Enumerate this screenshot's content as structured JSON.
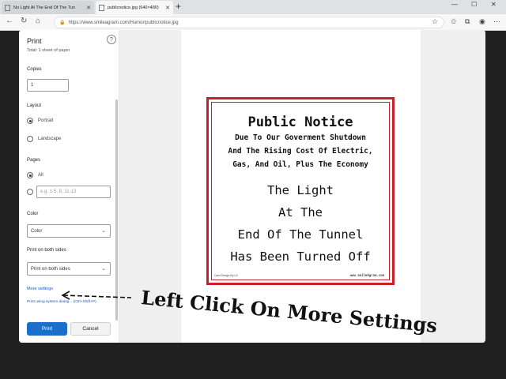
{
  "browser": {
    "tabs": [
      {
        "title": "No Light At The End Of The Tun",
        "active": false
      },
      {
        "title": "publicnotice.jpg (640×480)",
        "active": true
      }
    ],
    "url": "https://www.smileagram.com/Humor/publicnotice.jpg",
    "icons": [
      "back-icon",
      "refresh-icon",
      "home-icon",
      "lock-icon",
      "star-icon",
      "favorites-icon",
      "collections-icon",
      "profile-icon",
      "more-icon"
    ]
  },
  "print_panel": {
    "title": "Print",
    "subtitle": "Total: 1 sheet of paper",
    "help": "?",
    "copies": {
      "label": "Copies",
      "value": "1"
    },
    "layout": {
      "label": "Layout",
      "options": [
        "Portrait",
        "Landscape"
      ],
      "selected": "Portrait"
    },
    "pages": {
      "label": "Pages",
      "all_label": "All",
      "placeholder": "e.g. 1-5, 8, 11-13",
      "selected": "All"
    },
    "color": {
      "label": "Color",
      "value": "Color"
    },
    "duplex": {
      "label": "Print on both sides",
      "value": "Print on both sides"
    },
    "more_settings": "More settings",
    "system_dialog": "Print using system dialog... (Ctrl+Shift+P)",
    "print_button": "Print",
    "cancel_button": "Cancel"
  },
  "notice": {
    "heading": "Public Notice",
    "sub_lines": [
      "Due To Our Goverment Shutdown",
      "And The Rising Cost Of Electric,",
      "Gas, And Oil, Plus The Economy"
    ],
    "big_lines": [
      "The Light",
      "At The",
      "End Of The Tunnel",
      "Has Been Turned Off"
    ],
    "foot_left": "Card Design By LS",
    "foot_right": "www.smileAgram.com",
    "border_color": "#c8202a"
  },
  "annotation": {
    "text": "Left Click On More Settings"
  }
}
